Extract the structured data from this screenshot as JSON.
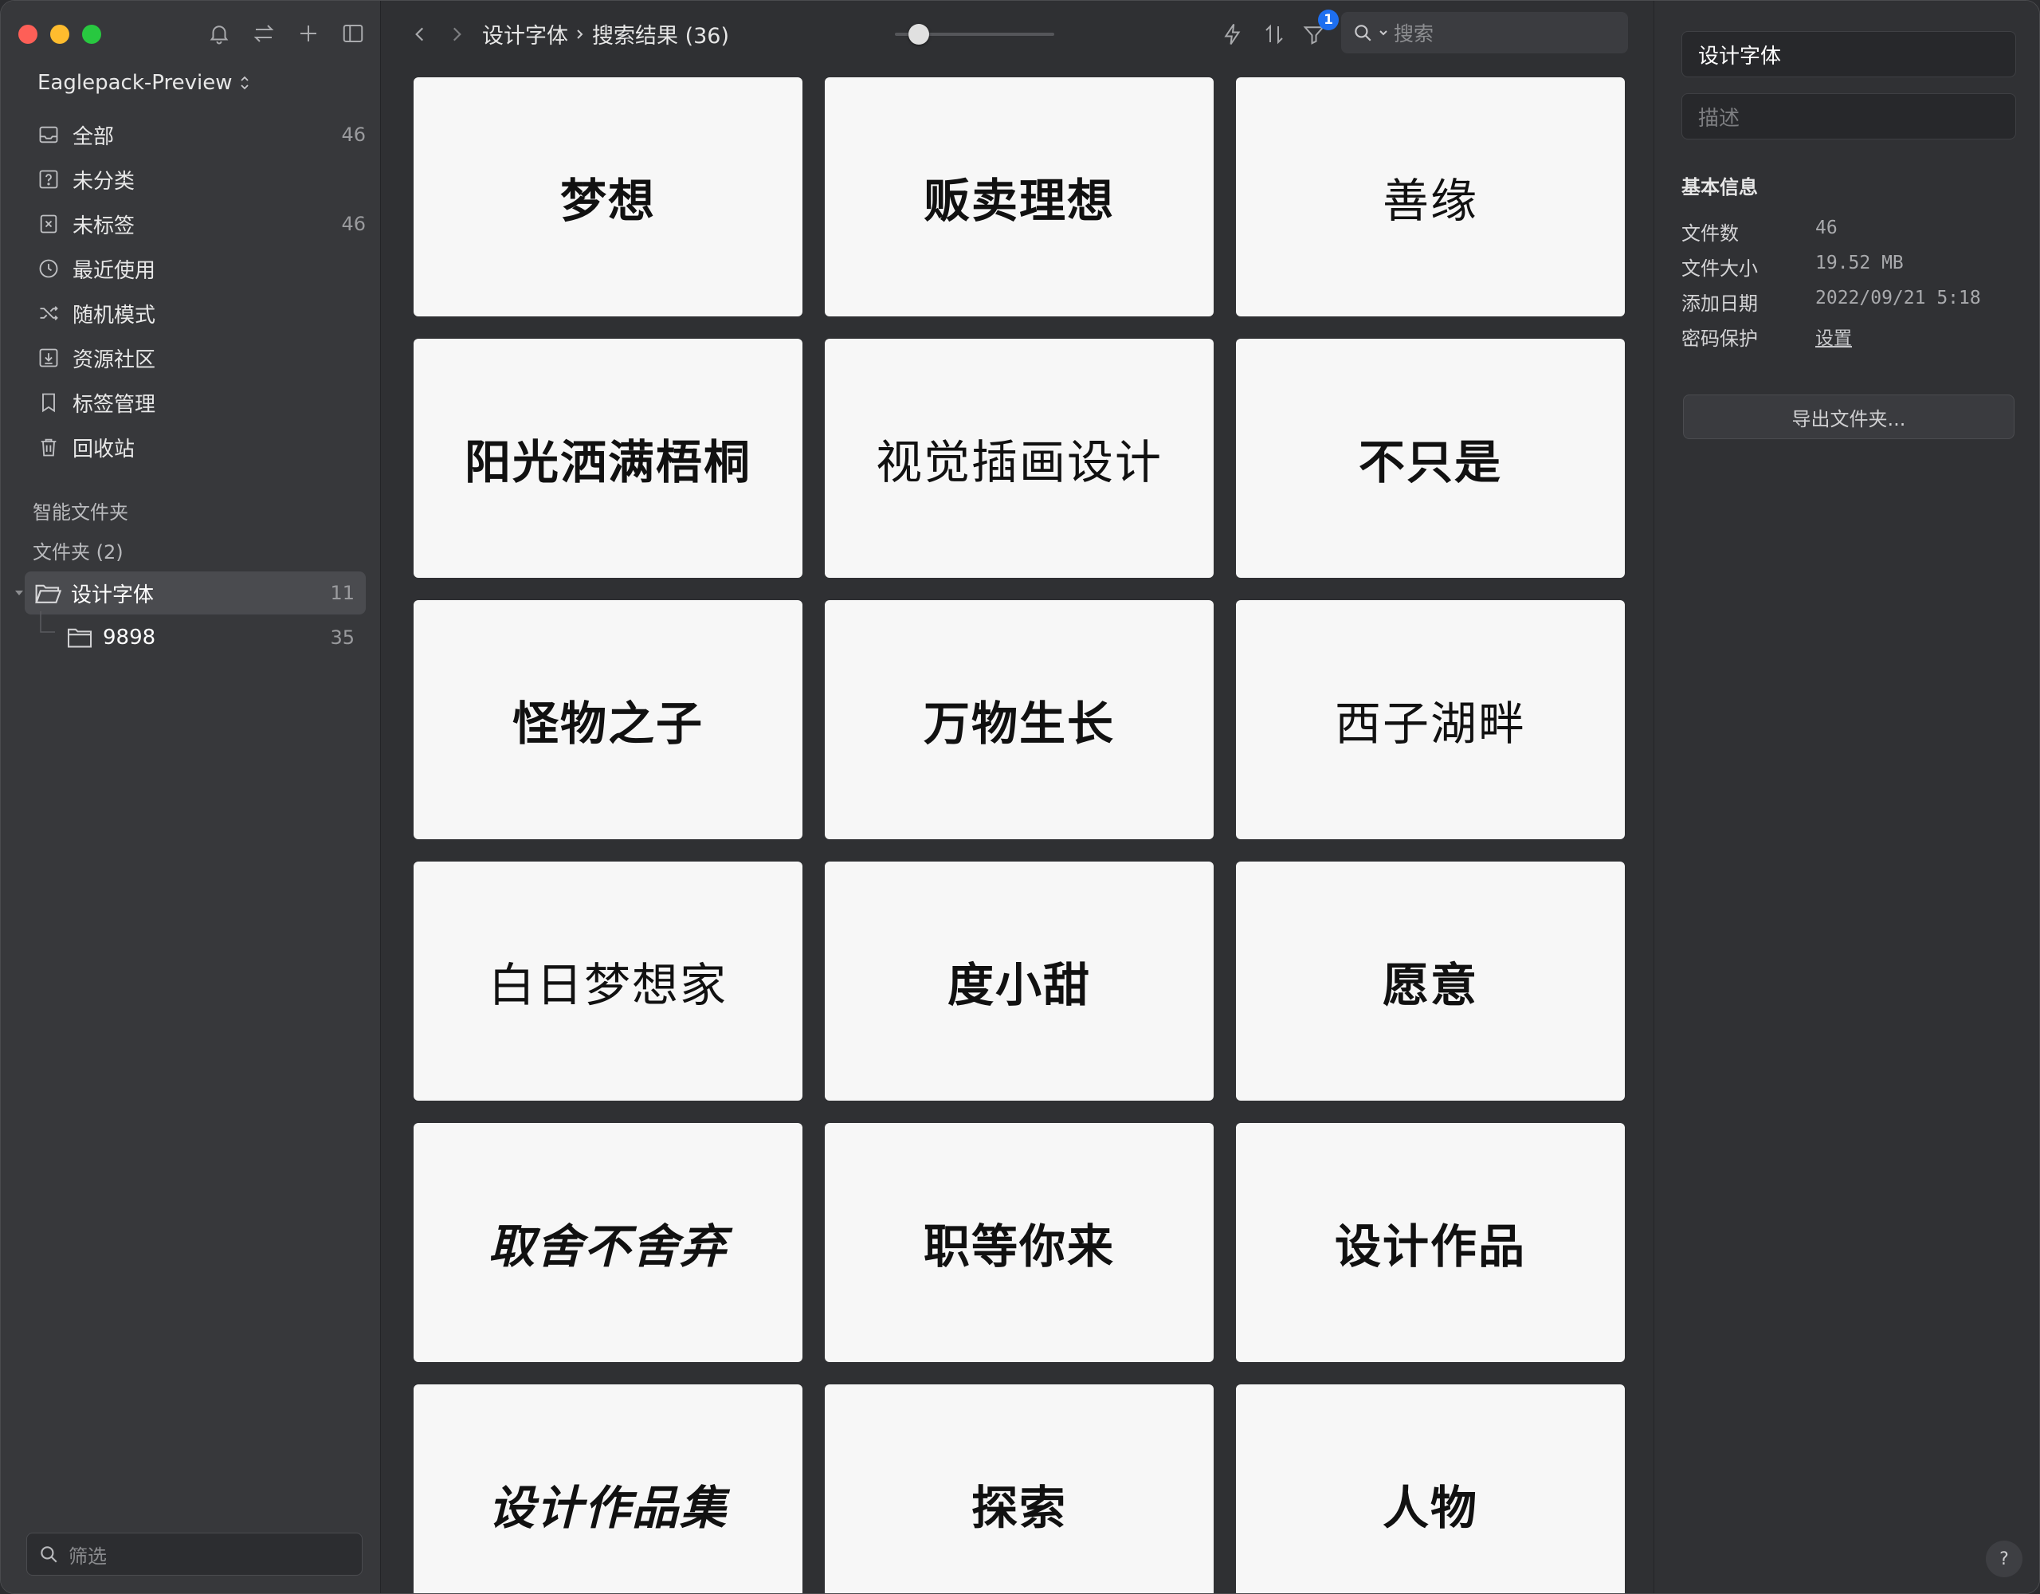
{
  "sidebar": {
    "library_name": "Eaglepack-Preview",
    "nav": [
      {
        "label": "全部",
        "count": "46",
        "icon": "inbox-icon"
      },
      {
        "label": "未分类",
        "count": "",
        "icon": "question-square-icon"
      },
      {
        "label": "未标签",
        "count": "46",
        "icon": "untagged-icon"
      },
      {
        "label": "最近使用",
        "count": "",
        "icon": "clock-icon"
      },
      {
        "label": "随机模式",
        "count": "",
        "icon": "shuffle-icon"
      },
      {
        "label": "资源社区",
        "count": "",
        "icon": "download-box-icon"
      },
      {
        "label": "标签管理",
        "count": "",
        "icon": "bookmark-icon"
      },
      {
        "label": "回收站",
        "count": "",
        "icon": "trash-icon"
      }
    ],
    "smart_folders_title": "智能文件夹",
    "folders_title": "文件夹 (2)",
    "folders": [
      {
        "label": "设计字体",
        "count": "11"
      },
      {
        "label": "9898",
        "count": "35"
      }
    ],
    "filter_placeholder": "筛选"
  },
  "toolbar": {
    "breadcrumb_parent": "设计字体",
    "breadcrumb_current": "搜索结果 (36)",
    "filter_badge": "1",
    "search_placeholder": "搜索",
    "zoom_level": 0.1
  },
  "grid": {
    "items": [
      {
        "text": "梦想",
        "style": "bold"
      },
      {
        "text": "贩卖理想",
        "style": "bold"
      },
      {
        "text": "善缘",
        "style": "thin"
      },
      {
        "text": "阳光洒满梧桐",
        "style": "bold"
      },
      {
        "text": "视觉插画设计",
        "style": "thin"
      },
      {
        "text": "不只是",
        "style": "bold"
      },
      {
        "text": "怪物之子",
        "style": "bold"
      },
      {
        "text": "万物生长",
        "style": "bold"
      },
      {
        "text": "西子湖畔",
        "style": "thin"
      },
      {
        "text": "白日梦想家",
        "style": "thin"
      },
      {
        "text": "度小甜",
        "style": "bold"
      },
      {
        "text": "愿意",
        "style": "bold"
      },
      {
        "text": "取舍不舍弃",
        "style": "italic"
      },
      {
        "text": "职等你来",
        "style": "bold"
      },
      {
        "text": "设计作品",
        "style": "bold"
      },
      {
        "text": "设计作品集",
        "style": "italic"
      },
      {
        "text": "探索",
        "style": "bold"
      },
      {
        "text": "人物",
        "style": "bold"
      }
    ]
  },
  "inspector": {
    "name_value": "设计字体",
    "description_placeholder": "描述",
    "section_title": "基本信息",
    "rows": [
      {
        "key": "文件数",
        "value": "46"
      },
      {
        "key": "文件大小",
        "value": "19.52 MB"
      },
      {
        "key": "添加日期",
        "value": "2022/09/21 5:18"
      },
      {
        "key": "密码保护",
        "value": "设置"
      }
    ],
    "export_label": "导出文件夹...",
    "help_label": "?"
  },
  "colors": {
    "accent": "#1e6ff0",
    "window_bg": "#2f3033",
    "sidebar_bg": "#37383b",
    "card_bg": "#f7f7f7"
  }
}
